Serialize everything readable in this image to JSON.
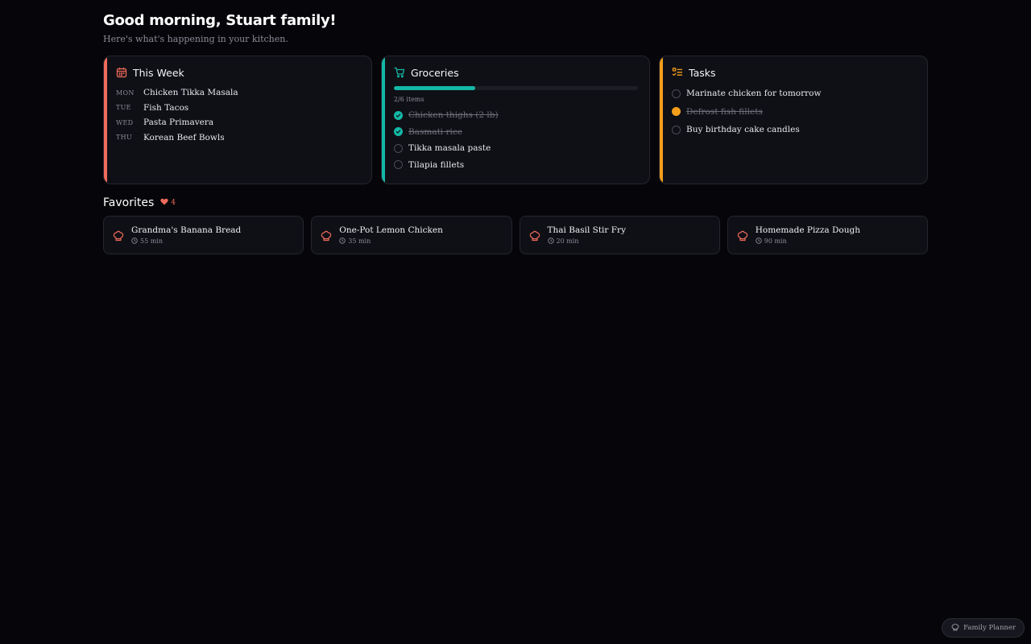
{
  "header": {
    "greeting": "Good morning, Stuart family!",
    "subtitle": "Here's what's happening in your kitchen."
  },
  "week": {
    "title": "This Week",
    "icon": "calendar-icon",
    "accent": "#ef6a5a",
    "meals": [
      {
        "day": "MON",
        "meal": "Chicken Tikka Masala"
      },
      {
        "day": "TUE",
        "meal": "Fish Tacos"
      },
      {
        "day": "WED",
        "meal": "Pasta Primavera"
      },
      {
        "day": "THU",
        "meal": "Korean Beef Bowls"
      }
    ]
  },
  "groceries": {
    "title": "Groceries",
    "icon": "cart-icon",
    "accent": "#14b8a6",
    "progress_fraction": 0.333,
    "progress_label": "2/6 items",
    "items": [
      {
        "label": "Chicken thighs (2 lb)",
        "done": true
      },
      {
        "label": "Basmati rice",
        "done": true
      },
      {
        "label": "Tikka masala paste",
        "done": false
      },
      {
        "label": "Tilapia fillets",
        "done": false
      }
    ]
  },
  "tasks": {
    "title": "Tasks",
    "icon": "checklist-icon",
    "accent": "#f59e1b",
    "items": [
      {
        "label": "Marinate chicken for tomorrow",
        "done": false
      },
      {
        "label": "Defrost fish fillets",
        "done": true
      },
      {
        "label": "Buy birthday cake candles",
        "done": false
      }
    ]
  },
  "favorites": {
    "title": "Favorites",
    "count": "4",
    "icon": "heart-icon",
    "recipes": [
      {
        "name": "Grandma's Banana Bread",
        "time": "55 min"
      },
      {
        "name": "One-Pot Lemon Chicken",
        "time": "35 min"
      },
      {
        "name": "Thai Basil Stir Fry",
        "time": "20 min"
      },
      {
        "name": "Homemade Pizza Dough",
        "time": "90 min"
      }
    ]
  },
  "badge": {
    "label": "Family Planner",
    "icon": "chef-hat-icon"
  }
}
